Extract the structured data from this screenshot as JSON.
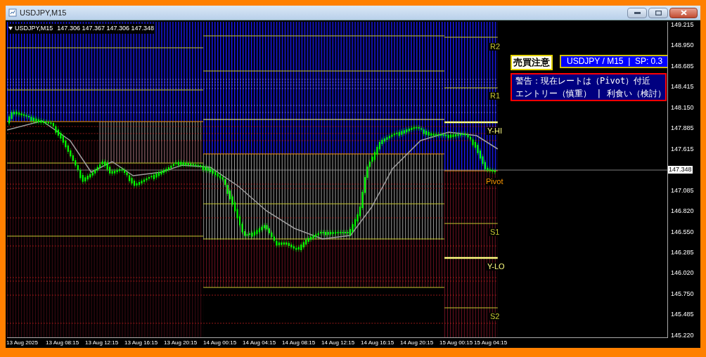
{
  "window": {
    "title": "USDJPY,M15"
  },
  "chart": {
    "info": {
      "symbol": "USDJPY,M15",
      "ohlc": [
        "147.306",
        "147.367",
        "147.306",
        "147.348"
      ]
    },
    "levels": [
      {
        "label": "R2",
        "color": "#c8c832"
      },
      {
        "label": "R1",
        "color": "#c8c832"
      },
      {
        "label": "Y-HI",
        "color": "#ffff80"
      },
      {
        "label": "Pivot",
        "color": "#ff9900"
      },
      {
        "label": "S1",
        "color": "#c8c832"
      },
      {
        "label": "Y-LO",
        "color": "#ffff80"
      },
      {
        "label": "S2",
        "color": "#c8c832"
      }
    ],
    "caution": "売買注意",
    "symbol_badge": "USDJPY / M15  |  SP: 0.3",
    "warning": [
      "警告：現在レートは（Pivot）付近",
      "エントリー（慎重） | 利食い（検討）"
    ],
    "price_axis": [
      {
        "label": "149.215",
        "current": false
      },
      {
        "label": "148.950",
        "current": false
      },
      {
        "label": "148.685",
        "current": false
      },
      {
        "label": "148.415",
        "current": false
      },
      {
        "label": "148.150",
        "current": false
      },
      {
        "label": "147.885",
        "current": false
      },
      {
        "label": "147.615",
        "current": false
      },
      {
        "label": "147.348",
        "current": true
      },
      {
        "label": "147.085",
        "current": false
      },
      {
        "label": "146.820",
        "current": false
      },
      {
        "label": "146.550",
        "current": false
      },
      {
        "label": "146.285",
        "current": false
      },
      {
        "label": "146.020",
        "current": false
      },
      {
        "label": "145.750",
        "current": false
      },
      {
        "label": "145.485",
        "current": false
      },
      {
        "label": "145.220",
        "current": false
      }
    ],
    "time_axis": [
      "13 Aug 2025",
      "13 Aug 08:15",
      "13 Aug 12:15",
      "13 Aug 16:15",
      "13 Aug 20:15",
      "14 Aug 00:15",
      "14 Aug 04:15",
      "14 Aug 08:15",
      "14 Aug 12:15",
      "14 Aug 16:15",
      "14 Aug 20:15",
      "15 Aug 00:15",
      "15 Aug 04:15"
    ]
  }
}
